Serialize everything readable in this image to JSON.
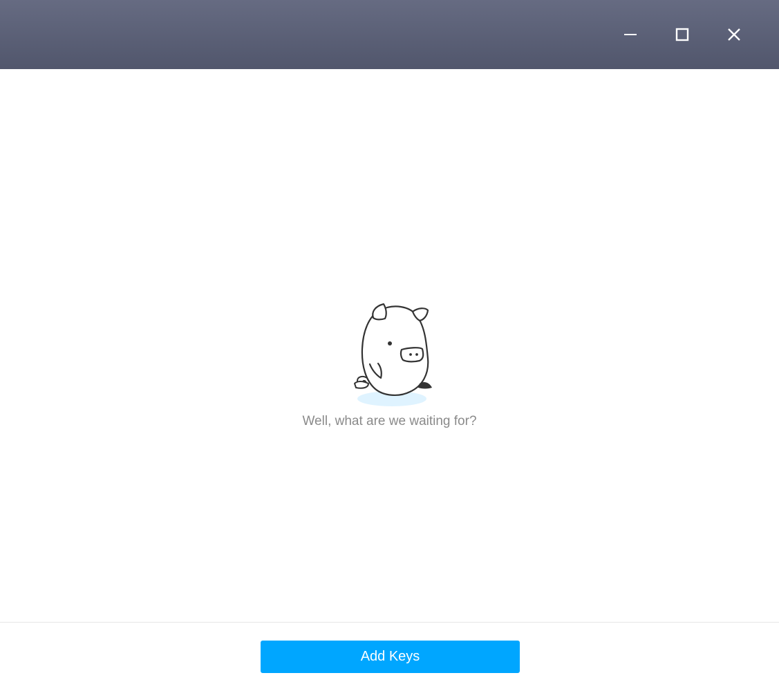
{
  "titlebar": {
    "minimize_icon": "minimize-icon",
    "maximize_icon": "maximize-icon",
    "close_icon": "close-icon"
  },
  "empty_state": {
    "illustration": "pig-illustration",
    "message": "Well, what are we waiting for?"
  },
  "footer": {
    "add_keys_label": "Add Keys"
  },
  "colors": {
    "titlebar_top": "#666b82",
    "titlebar_bottom": "#51566c",
    "accent": "#00a6ff",
    "message_text": "#8a8a8a"
  }
}
